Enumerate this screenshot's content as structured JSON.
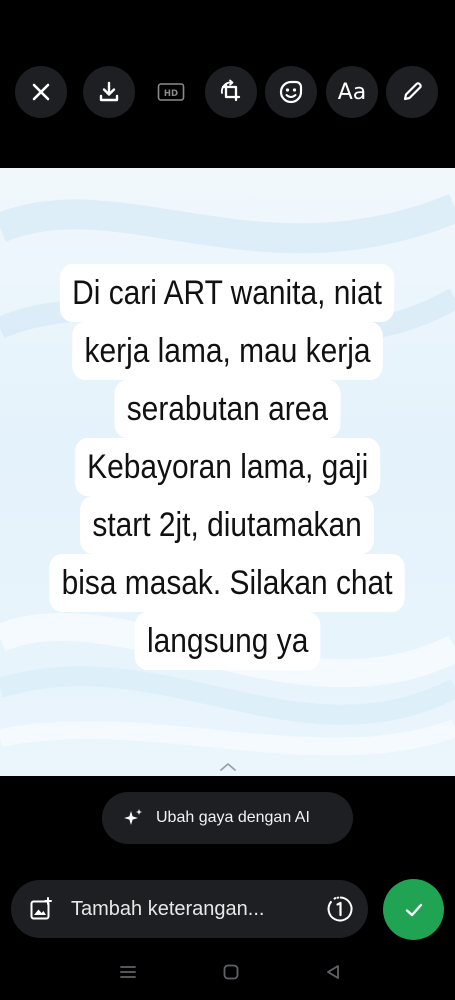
{
  "toolbar": {
    "items": [
      {
        "name": "close",
        "icon": "close-icon"
      },
      {
        "name": "download",
        "icon": "download-icon"
      },
      {
        "name": "hd-quality",
        "icon": "hd-icon",
        "label": "HD"
      },
      {
        "name": "crop-rotate",
        "icon": "crop-rotate-icon"
      },
      {
        "name": "sticker",
        "icon": "sticker-icon"
      },
      {
        "name": "text",
        "icon": "text-icon",
        "label": "Aa"
      },
      {
        "name": "draw",
        "icon": "pencil-icon"
      }
    ]
  },
  "image_text": {
    "lines": [
      "Di cari ART wanita, niat",
      "kerja lama, mau kerja",
      "serabutan area",
      "Kebayoran lama, gaji",
      "start 2jt, diutamakan",
      "bisa masak. Silakan chat",
      "langsung ya"
    ]
  },
  "ai_style": {
    "label": "Ubah gaya dengan AI",
    "icon": "sparkle-icon"
  },
  "caption": {
    "placeholder": "Tambah keterangan...",
    "view_once_icon": "view-once-icon",
    "gallery_icon": "add-image-icon"
  },
  "send": {
    "icon": "check-icon",
    "color": "#21a354"
  },
  "system_nav": {
    "items": [
      "recent-apps-icon",
      "home-icon",
      "back-icon"
    ]
  }
}
